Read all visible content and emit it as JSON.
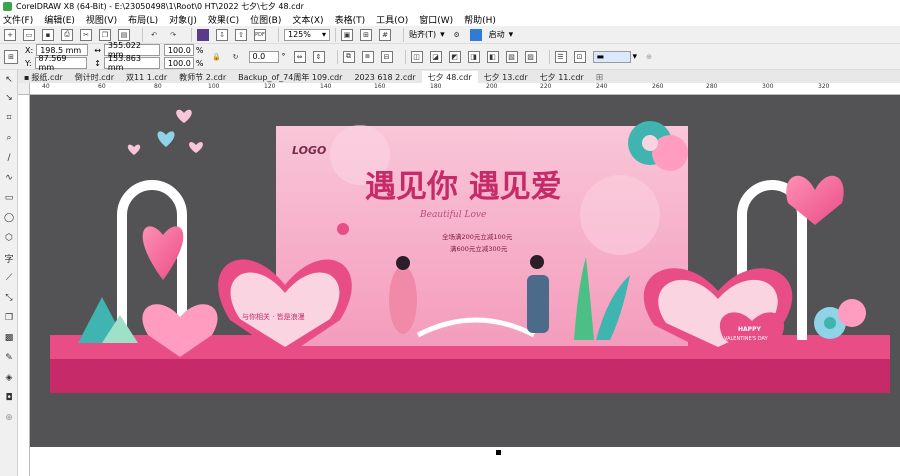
{
  "window": {
    "title": "CorelDRAW X8 (64-Bit) - E:\\23050498\\1\\Root\\0 HT\\2022 七夕\\七夕 48.cdr"
  },
  "menu": [
    {
      "label": "文件(F)"
    },
    {
      "label": "编辑(E)"
    },
    {
      "label": "视图(V)"
    },
    {
      "label": "布局(L)"
    },
    {
      "label": "对象(J)"
    },
    {
      "label": "效果(C)"
    },
    {
      "label": "位图(B)"
    },
    {
      "label": "文本(X)"
    },
    {
      "label": "表格(T)"
    },
    {
      "label": "工具(O)"
    },
    {
      "label": "窗口(W)"
    },
    {
      "label": "帮助(H)"
    }
  ],
  "std_toolbar": {
    "zoom": "125%",
    "snap_label": "贴齐(T)",
    "launch_label": "启动"
  },
  "properties": {
    "x": "198.5 mm",
    "y": "87.569 mm",
    "width": "355.022 mm",
    "height": "153.863 mm",
    "scale_w": "100.0",
    "scale_h": "100.0",
    "scale_unit": "%",
    "rotation": "0.0",
    "x_label": "X:",
    "y_label": "Y:"
  },
  "tabs": [
    {
      "label": "报纸.cdr",
      "active": false
    },
    {
      "label": "倒计时.cdr",
      "active": false
    },
    {
      "label": "双11 1.cdr",
      "active": false
    },
    {
      "label": "教师节 2.cdr",
      "active": false
    },
    {
      "label": "Backup_of_74周年 109.cdr",
      "active": false
    },
    {
      "label": "2023 618 2.cdr",
      "active": false
    },
    {
      "label": "七夕 48.cdr",
      "active": true
    },
    {
      "label": "七夕 13.cdr",
      "active": false
    },
    {
      "label": "七夕 11.cdr",
      "active": false
    }
  ],
  "ruler_ticks": [
    "40",
    "60",
    "80",
    "100",
    "120",
    "140",
    "160",
    "180",
    "200",
    "220",
    "240",
    "260",
    "280",
    "300",
    "320"
  ],
  "design": {
    "logo": "LOGO",
    "headline": "遇见你 遇见爱",
    "subtitle_script": "Beautiful Love",
    "promo_line1": "全场满200元立减100元",
    "promo_line2": "满600元立减300元",
    "left_heart_text": "与你相关 · 皆是浪漫",
    "happy": "HAPPY",
    "valentines": "VALENTINE'S DAY"
  },
  "colors": {
    "accent_pink": "#e94d86",
    "deep_pink": "#c62a68",
    "workspace_gray": "#535355",
    "teal": "#3fb4b0"
  }
}
